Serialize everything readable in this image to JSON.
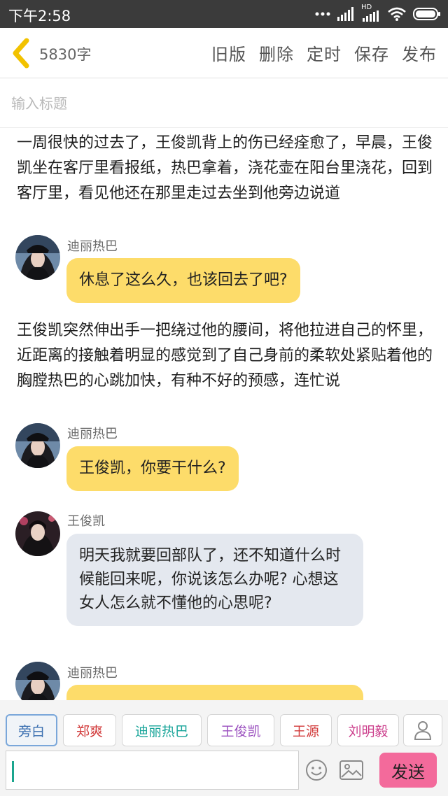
{
  "status": {
    "time": "下午2:58",
    "network_label": "HD"
  },
  "toolbar": {
    "word_count": "5830字",
    "actions": [
      "旧版",
      "删除",
      "定时",
      "保存",
      "发布"
    ]
  },
  "title_input": {
    "placeholder": "输入标题",
    "value": ""
  },
  "story": {
    "narration_1": "一周很快的过去了，王俊凯背上的伤已经痊愈了，早晨，王俊凯坐在客厅里看报纸，热巴拿着，浇花壶在阳台里浇花，回到客厅里，看见他还在那里走过去坐到他旁边说道",
    "messages": [
      {
        "speaker": "迪丽热巴",
        "text": "休息了这么久，也该回去了吧?",
        "style": "yellow"
      },
      {
        "speaker": "迪丽热巴",
        "text": "王俊凯，你要干什么?",
        "style": "yellow"
      },
      {
        "speaker": "王俊凯",
        "text": "明天我就要回部队了，还不知道什么时候能回来呢，你说该怎么办呢? 心想这女人怎么就不懂他的心思呢?",
        "style": "gray"
      },
      {
        "speaker": "迪丽热巴",
        "text": "",
        "style": "yellow"
      }
    ],
    "narration_2": "王俊凯突然伸出手一把绕过他的腰间，将他拉进自己的怀里，近距离的接触着明显的感觉到了自己身前的柔软处紧贴着他的胸膛热巴的心跳加快，有种不好的预感，连忙说"
  },
  "characters": [
    {
      "label": "旁白",
      "color": "#3a6fb0",
      "active": true
    },
    {
      "label": "郑爽",
      "color": "#d23b3b",
      "active": false
    },
    {
      "label": "迪丽热巴",
      "color": "#1aa59a",
      "active": false
    },
    {
      "label": "王俊凯",
      "color": "#9a4fbf",
      "active": false
    },
    {
      "label": "王源",
      "color": "#d23b3b",
      "active": false
    },
    {
      "label": "刘明毅",
      "color": "#cc3f8c",
      "active": false
    }
  ],
  "input_bar": {
    "message_value": "",
    "send_label": "发送"
  },
  "colors": {
    "accent_yellow": "#fddc6a",
    "bubble_gray": "#e4e8ef",
    "send_pink": "#f36a9b",
    "back_arrow": "#f2c200"
  },
  "icons": [
    "back-arrow-icon",
    "signal-icon",
    "wifi-icon",
    "battery-icon",
    "emoji-icon",
    "image-icon",
    "person-icon"
  ]
}
